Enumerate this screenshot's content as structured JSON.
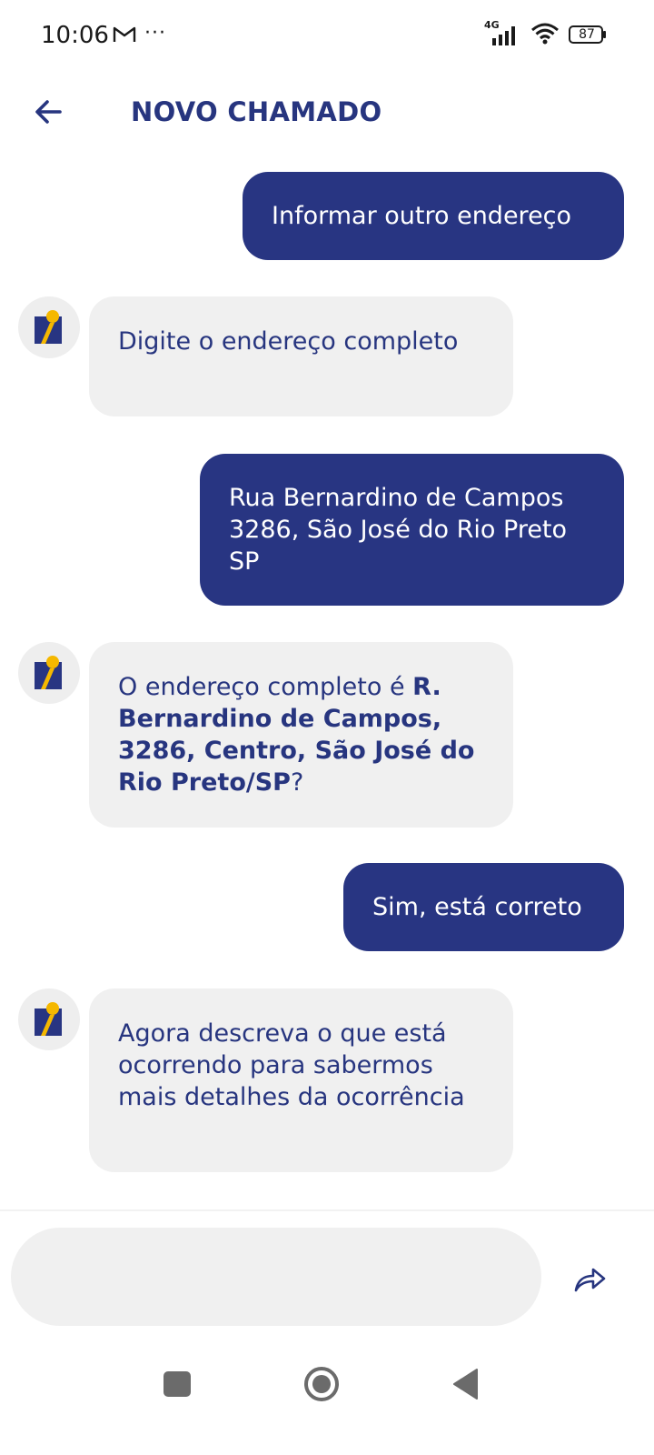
{
  "status_bar": {
    "time": "10:06",
    "network": "4G",
    "battery_level": "87",
    "icons": [
      "gmail-icon",
      "more-dots-icon",
      "signal-icon",
      "wifi-icon",
      "battery-icon"
    ]
  },
  "header": {
    "title": "NOVO CHAMADO",
    "back_icon": "arrow-left-icon"
  },
  "messages": [
    {
      "sender": "user",
      "text": "Informar outro endereço"
    },
    {
      "sender": "bot",
      "text": "Digite o endereço completo"
    },
    {
      "sender": "user",
      "text": "Rua Bernardino de Campos 3286, São José do Rio Preto SP"
    },
    {
      "sender": "bot",
      "text_prefix": "O endereço completo é ",
      "text_bold": "R. Bernardino de Campos, 3286, Centro, São José do Rio Preto/SP",
      "text_suffix": "?"
    },
    {
      "sender": "user",
      "text": "Sim, está correto"
    },
    {
      "sender": "bot",
      "text": "Agora descreva o que está ocorrendo para sabermos mais detalhes da ocorrência"
    }
  ],
  "composer": {
    "value": "",
    "placeholder": "",
    "send_icon": "send-arrow-icon"
  },
  "nav": {
    "icons": [
      "recents-square-icon",
      "home-circle-icon",
      "back-triangle-icon"
    ]
  },
  "colors": {
    "primary": "#283582",
    "bot_bubble": "#f0f0f0",
    "text_dark_blue": "#27357f",
    "logo_yellow": "#f5b800"
  }
}
